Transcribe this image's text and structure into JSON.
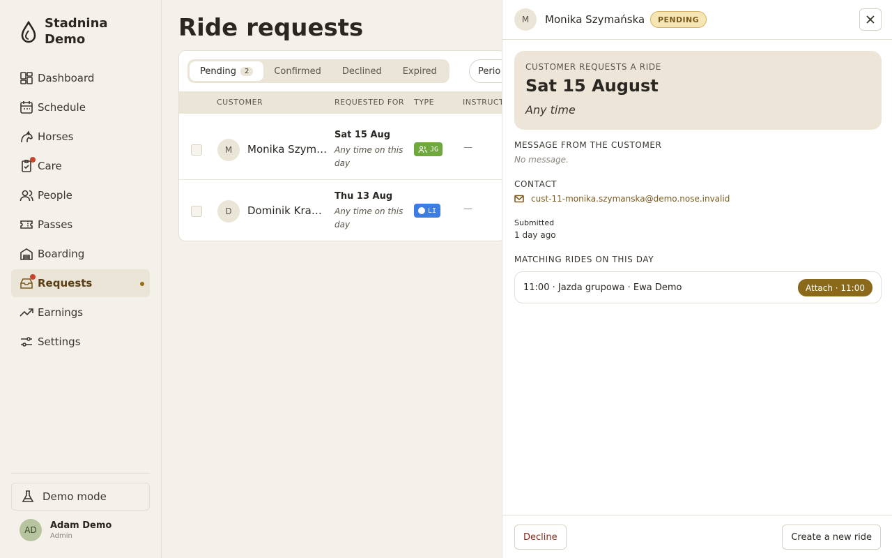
{
  "brand": {
    "name": "Stadnina Demo",
    "icon": "droplet-logo-icon"
  },
  "nav": [
    {
      "label": "Dashboard",
      "icon": "dashboard-icon"
    },
    {
      "label": "Schedule",
      "icon": "calendar-icon"
    },
    {
      "label": "Horses",
      "icon": "horse-icon"
    },
    {
      "label": "Care",
      "icon": "clipboard-icon",
      "alert": true
    },
    {
      "label": "People",
      "icon": "people-icon"
    },
    {
      "label": "Passes",
      "icon": "ticket-icon"
    },
    {
      "label": "Boarding",
      "icon": "building-icon"
    },
    {
      "label": "Requests",
      "icon": "inbox-icon",
      "alert": true,
      "active": true
    },
    {
      "label": "Earnings",
      "icon": "trend-icon"
    },
    {
      "label": "Settings",
      "icon": "sliders-icon"
    }
  ],
  "demo_mode": "Demo mode",
  "user": {
    "initials": "AD",
    "name": "Adam Demo",
    "role": "Admin"
  },
  "page": {
    "title": "Ride requests"
  },
  "tabs": [
    {
      "label": "Pending",
      "count": "2",
      "active": true
    },
    {
      "label": "Confirmed"
    },
    {
      "label": "Declined"
    },
    {
      "label": "Expired"
    }
  ],
  "period_label": "Perio",
  "columns": {
    "customer": "CUSTOMER",
    "requested_for": "REQUESTED FOR",
    "type": "TYPE",
    "instructor": "INSTRUCT"
  },
  "rows": [
    {
      "initial": "M",
      "name": "Monika Szymańska",
      "date": "Sat 15 Aug",
      "when": "Any time on this day",
      "type": "JG",
      "type_color": "#6fa83d",
      "instructor": "—"
    },
    {
      "initial": "D",
      "name": "Dominik Krawczyk",
      "date": "Thu 13 Aug",
      "when": "Any time on this day",
      "type": "LI",
      "type_color": "#3b7de0",
      "instructor": "—"
    }
  ],
  "drawer": {
    "initial": "M",
    "name": "Monika Szymańska",
    "status": "PENDING",
    "hero_label": "CUSTOMER REQUESTS A RIDE",
    "hero_date": "Sat 15 August",
    "hero_time": "Any time",
    "message_label": "MESSAGE FROM THE CUSTOMER",
    "message": "No message.",
    "contact_label": "CONTACT",
    "email": "cust-11-monika.szymanska@demo.nose.invalid",
    "submitted_label": "Submitted",
    "submitted": "1 day ago",
    "matching_label": "MATCHING RIDES ON THIS DAY",
    "match_text": "11:00 · Jazda grupowa · Ewa Demo",
    "attach_label": "Attach · 11:00",
    "decline_label": "Decline",
    "create_label": "Create a new ride"
  },
  "colors": {
    "accent": "#8a6a1a",
    "alert": "#c8432b",
    "pending_bg": "#f6e6b6"
  }
}
